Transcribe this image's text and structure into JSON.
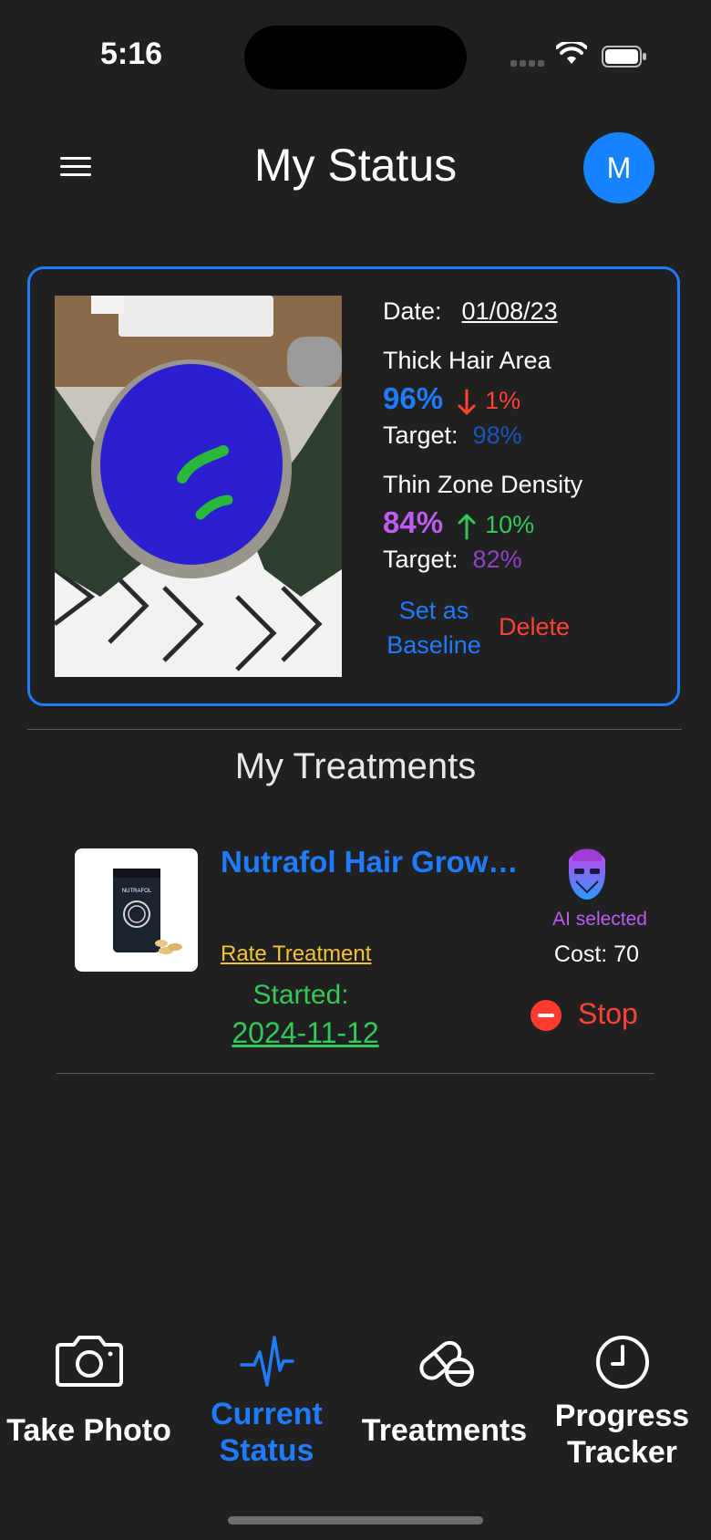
{
  "status_bar": {
    "time": "5:16"
  },
  "header": {
    "title": "My Status",
    "avatar_initial": "M"
  },
  "status_card": {
    "date_label": "Date:",
    "date_value": "01/08/23",
    "thick_hair": {
      "label": "Thick Hair Area",
      "value": "96%",
      "trend_direction": "down",
      "change": "1%",
      "target_label": "Target:",
      "target_value": "98%"
    },
    "thin_zone": {
      "label": "Thin Zone Density",
      "value": "84%",
      "trend_direction": "up",
      "change": "10%",
      "target_label": "Target:",
      "target_value": "82%"
    },
    "set_baseline_line1": "Set as",
    "set_baseline_line2": "Baseline",
    "delete_label": "Delete"
  },
  "treatments_section": {
    "title": "My Treatments",
    "items": [
      {
        "name": "Nutrafol Hair Growt...",
        "product_brand": "NUTRAFOL",
        "rate_label": "Rate Treatment",
        "started_label": "Started:",
        "started_date": "2024-11-12",
        "ai_label": "AI selected",
        "cost_text": "Cost: 70",
        "stop_label": "Stop"
      }
    ]
  },
  "tab_bar": {
    "tabs": [
      {
        "icon": "camera-icon",
        "label": "Take Photo",
        "active": false
      },
      {
        "icon": "heartbeat-icon",
        "label_line1": "Current",
        "label_line2": "Status",
        "active": true
      },
      {
        "icon": "pill-icon",
        "label": "Treatments",
        "active": false
      },
      {
        "icon": "clock-icon",
        "label_line1": "Progress",
        "label_line2": "Tracker",
        "active": false
      }
    ]
  },
  "colors": {
    "background": "#202020",
    "accent_blue": "#1f7bff",
    "red": "#ff4236",
    "green": "#34c759",
    "purple": "#bf5af2",
    "yellow": "#f4c430",
    "target_blue": "#1956b8",
    "target_purple": "#8e44c7"
  }
}
